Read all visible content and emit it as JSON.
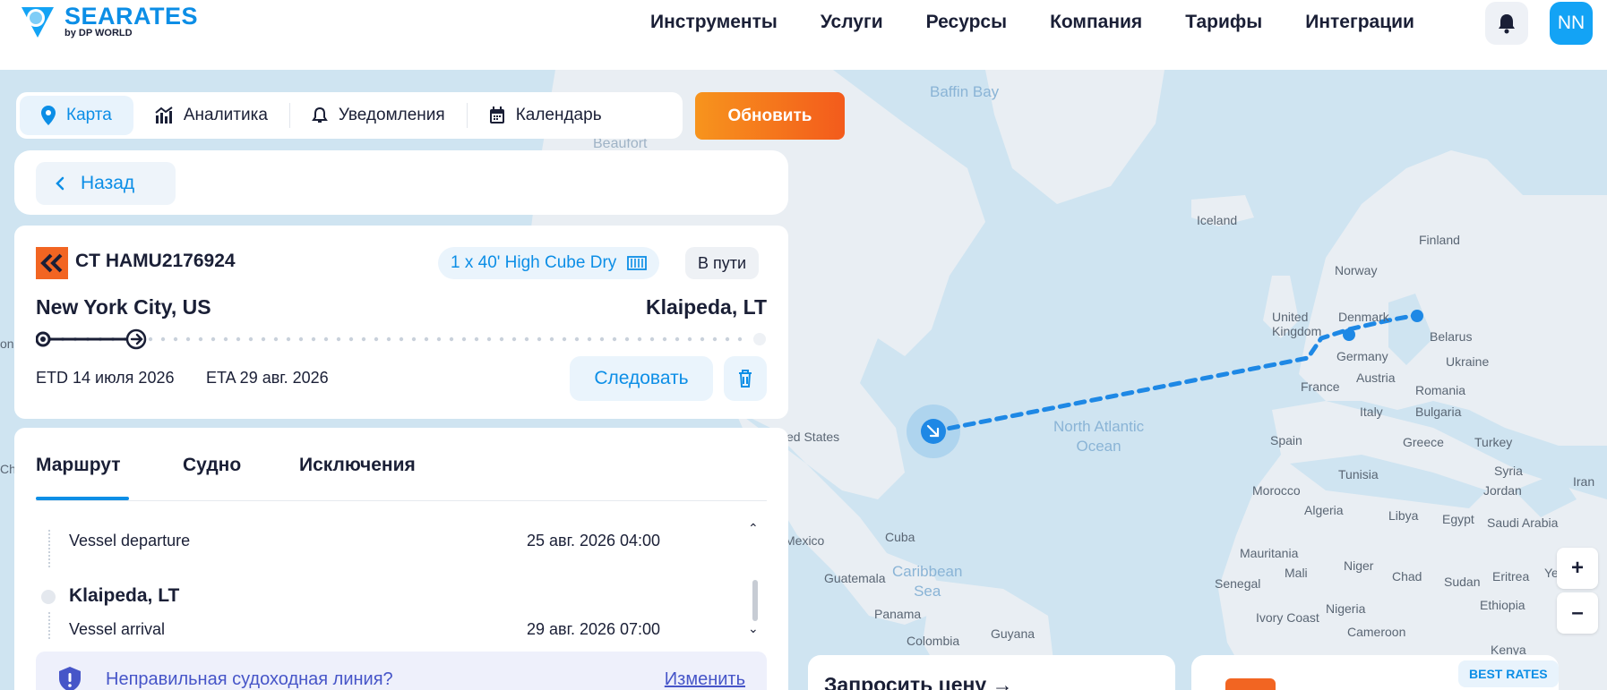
{
  "header": {
    "logo_name": "SEARATES",
    "logo_sub": "by DP WORLD",
    "nav": [
      "Инструменты",
      "Услуги",
      "Ресурсы",
      "Компания",
      "Тарифы",
      "Интеграции"
    ],
    "avatar": "NN"
  },
  "view_tabs": {
    "map": "Карта",
    "analytics": "Аналитика",
    "notifications": "Уведомления",
    "calendar": "Календарь"
  },
  "refresh_label": "Обновить",
  "back_label": "Назад",
  "shipment": {
    "id": "CT HAMU2176924",
    "container": "1 x 40' High Cube Dry",
    "status": "В пути",
    "from": "New York City, US",
    "to": "Klaipeda, LT",
    "progress": 0.13,
    "etd": "ETD 14 июля 2026",
    "eta": "ETA 29 авг. 2026",
    "follow_label": "Следовать"
  },
  "details": {
    "tabs": [
      "Маршрут",
      "Судно",
      "Исключения"
    ],
    "events": [
      {
        "label": "Vessel departure",
        "date": "25 авг. 2026 04:00"
      },
      {
        "port": "Klaipeda, LT"
      },
      {
        "label": "Vessel arrival",
        "date": "29 авг. 2026 07:00"
      }
    ],
    "warning_text": "Неправильная судоходная линия?",
    "warning_link": "Изменить"
  },
  "map": {
    "labels": {
      "baffin_bay": "Baffin Bay",
      "beaufort": "Beaufort",
      "iceland": "Iceland",
      "finland": "Finland",
      "norway": "Norway",
      "united_kingdom": "United\nKingdom",
      "denmark": "Denmark",
      "belarus": "Belarus",
      "germany": "Germany",
      "ukraine": "Ukraine",
      "france": "France",
      "austria": "Austria",
      "romania": "Romania",
      "italy": "Italy",
      "bulgaria": "Bulgaria",
      "spain": "Spain",
      "greece": "Greece",
      "turkey": "Turkey",
      "united_states": "ed States",
      "north_atlantic": "North Atlantic\nOcean",
      "tunisia": "Tunisia",
      "syria": "Syria",
      "iran": "Iran",
      "jordan": "Jordan",
      "morocco": "Morocco",
      "algeria": "Algeria",
      "libya": "Libya",
      "egypt": "Egypt",
      "saudi": "Saudi Arabia",
      "mexico": "Mexico",
      "cuba": "Cuba",
      "caribbean": "Caribbean\nSea",
      "guatemala": "Guatemala",
      "mauritania": "Mauritania",
      "mali": "Mali",
      "niger": "Niger",
      "chad": "Chad",
      "sudan": "Sudan",
      "eritrea": "Eritrea",
      "yem": "Yem",
      "senegal": "Senegal",
      "panama": "Panama",
      "guyana": "Guyana",
      "nigeria": "Nigeria",
      "ethiopia": "Ethiopia",
      "ivory_coast": "Ivory Coast",
      "colombia": "Colombia",
      "cameroon": "Cameroon",
      "kenya": "Kenya",
      "ong": "ong",
      "ch": "Ch"
    },
    "zoom_in": "+",
    "zoom_out": "–"
  },
  "bottom": {
    "quote_title": "Запросить цену →",
    "best_rates": "BEST RATES"
  },
  "colors": {
    "accent": "#0c8ee6",
    "orange": "#f35b1c",
    "route": "#1e88e5"
  }
}
